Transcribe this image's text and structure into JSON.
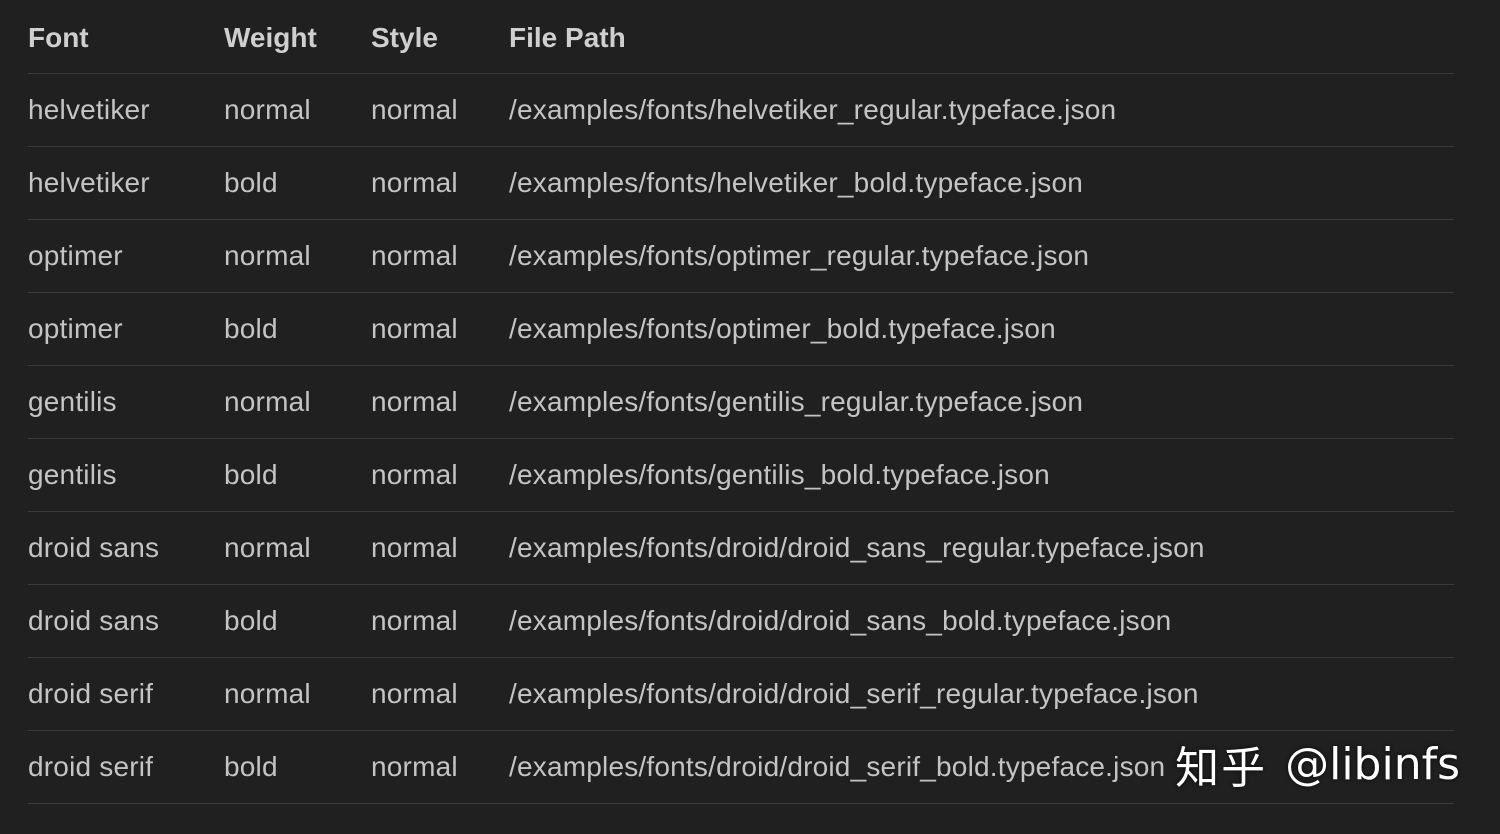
{
  "table": {
    "headers": {
      "font": "Font",
      "weight": "Weight",
      "style": "Style",
      "path": "File Path"
    },
    "rows": [
      {
        "font": "helvetiker",
        "weight": "normal",
        "style": "normal",
        "path": "/examples/fonts/helvetiker_regular.typeface.json"
      },
      {
        "font": "helvetiker",
        "weight": "bold",
        "style": "normal",
        "path": "/examples/fonts/helvetiker_bold.typeface.json"
      },
      {
        "font": "optimer",
        "weight": "normal",
        "style": "normal",
        "path": "/examples/fonts/optimer_regular.typeface.json"
      },
      {
        "font": "optimer",
        "weight": "bold",
        "style": "normal",
        "path": "/examples/fonts/optimer_bold.typeface.json"
      },
      {
        "font": "gentilis",
        "weight": "normal",
        "style": "normal",
        "path": "/examples/fonts/gentilis_regular.typeface.json"
      },
      {
        "font": "gentilis",
        "weight": "bold",
        "style": "normal",
        "path": "/examples/fonts/gentilis_bold.typeface.json"
      },
      {
        "font": "droid sans",
        "weight": "normal",
        "style": "normal",
        "path": "/examples/fonts/droid/droid_sans_regular.typeface.json"
      },
      {
        "font": "droid sans",
        "weight": "bold",
        "style": "normal",
        "path": "/examples/fonts/droid/droid_sans_bold.typeface.json"
      },
      {
        "font": "droid serif",
        "weight": "normal",
        "style": "normal",
        "path": "/examples/fonts/droid/droid_serif_regular.typeface.json"
      },
      {
        "font": "droid serif",
        "weight": "bold",
        "style": "normal",
        "path": "/examples/fonts/droid/droid_serif_bold.typeface.json"
      }
    ]
  },
  "watermark": {
    "site": "知乎",
    "handle": "@libinfs"
  },
  "colors": {
    "background": "#202020",
    "text": "#c4c4c4",
    "divider": "#3a3a3a"
  }
}
